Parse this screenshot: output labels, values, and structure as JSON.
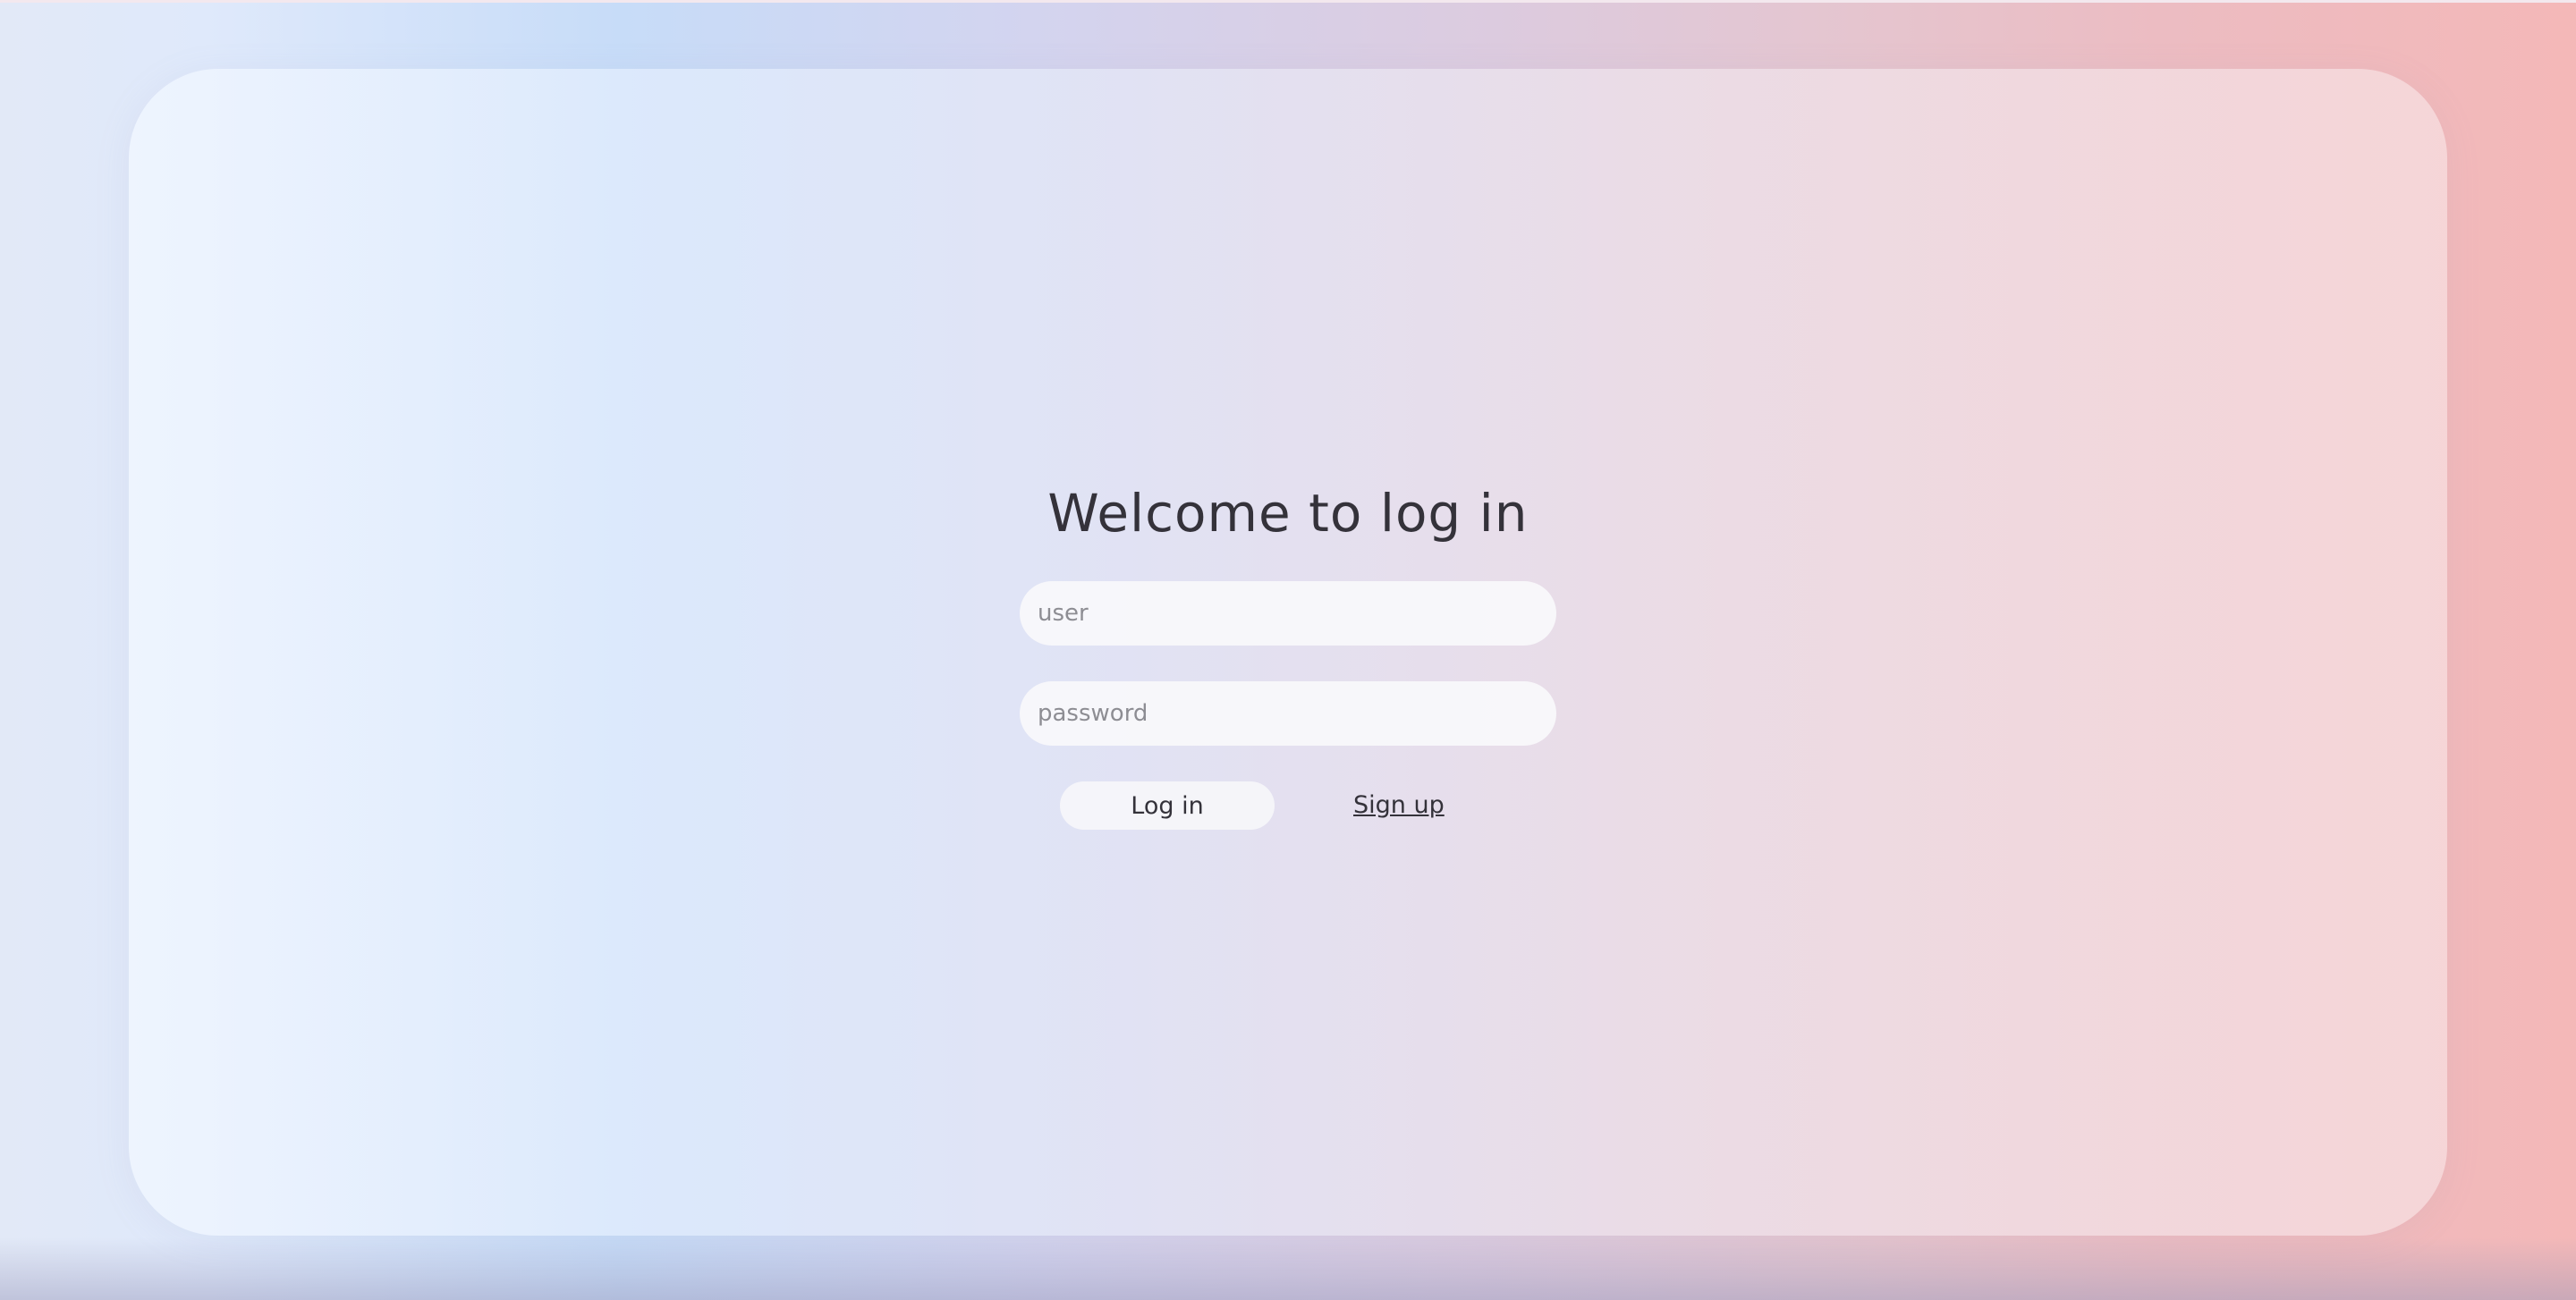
{
  "login": {
    "title": "Welcome to log in",
    "user_placeholder": "user",
    "user_value": "",
    "password_placeholder": "password",
    "password_value": "",
    "login_label": "Log in",
    "signup_label": "Sign up"
  },
  "colors": {
    "text": "#34323a",
    "placeholder": "#8d8d93",
    "field_background": "#f8f8fb",
    "gradient_left": "#c7dcf8",
    "gradient_right": "#f4b8b8"
  }
}
